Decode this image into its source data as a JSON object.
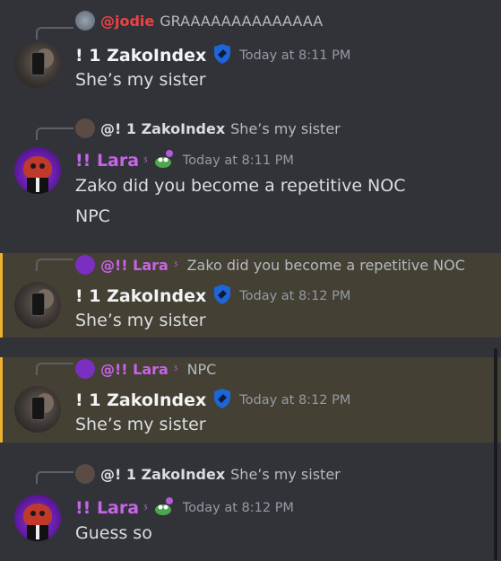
{
  "users": {
    "jodie_mention": "@jodie",
    "zako": "! 1 ZakoIndex",
    "zako_mention": "@! 1 ZakoIndex",
    "lara": "!! Lara",
    "lara_mention": "@!! Lara"
  },
  "colors": {
    "zako_name": "#f2f3f5",
    "lara_name": "#c864ea",
    "jodie_name": "#ed4245",
    "mention_bar": "#f0b132",
    "mention_bg": "#444033"
  },
  "messages": [
    {
      "reply_user": "@jodie",
      "reply_text": "GRAAAAAAAAAAAAAA",
      "author": "! 1 ZakoIndex",
      "time": "Today at 8:11 PM",
      "lines": [
        "She’s my sister"
      ]
    },
    {
      "reply_user": "@! 1 ZakoIndex",
      "reply_text": "She’s my sister",
      "author": "!! Lara",
      "time": "Today at 8:11 PM",
      "lines": [
        "Zako did you become a repetitive NOC",
        "NPC"
      ]
    },
    {
      "reply_user": "@!! Lara",
      "reply_text": "Zako did you become a repetitive NOC",
      "author": "! 1 ZakoIndex",
      "time": "Today at 8:12 PM",
      "lines": [
        "She’s my sister"
      ]
    },
    {
      "reply_user": "@!! Lara",
      "reply_text": "NPC",
      "author": "! 1 ZakoIndex",
      "time": "Today at 8:12 PM",
      "lines": [
        "She’s my sister"
      ]
    },
    {
      "reply_user": "@! 1 ZakoIndex",
      "reply_text": "She’s my sister",
      "author": "!! Lara",
      "time": "Today at 8:12 PM",
      "lines": [
        "Guess so"
      ]
    }
  ]
}
